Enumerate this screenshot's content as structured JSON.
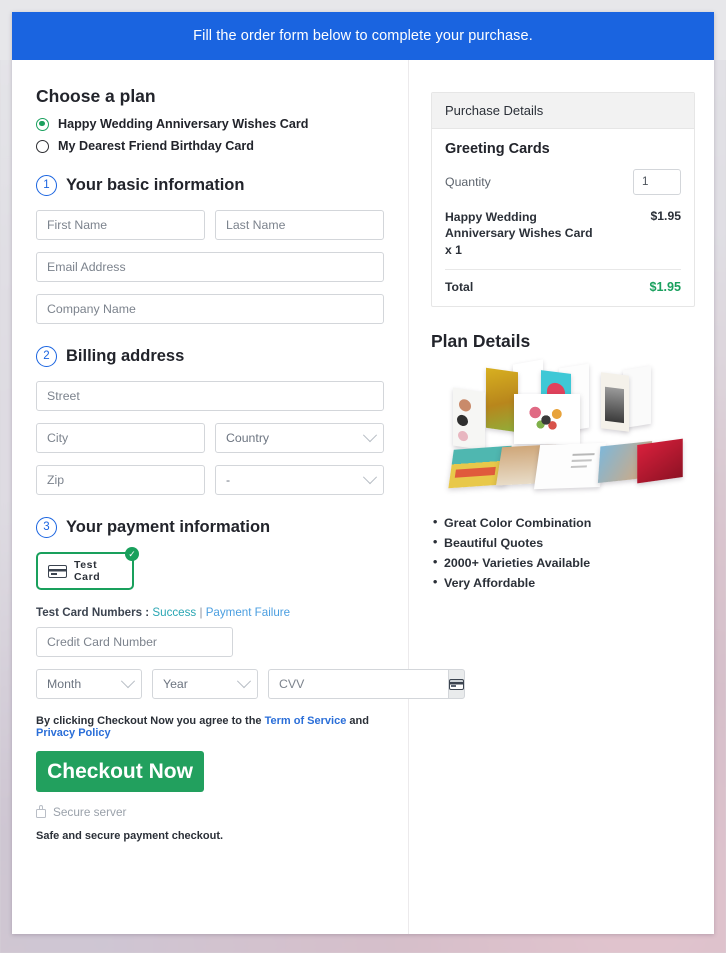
{
  "banner": {
    "text": "Fill the order form below to complete your purchase."
  },
  "plan": {
    "heading": "Choose a plan",
    "options": [
      {
        "label": "Happy Wedding Anniversary Wishes Card",
        "selected": true
      },
      {
        "label": "My Dearest Friend Birthday Card",
        "selected": false
      }
    ]
  },
  "steps": {
    "basic": {
      "num": "1",
      "label": "Your basic information"
    },
    "billing": {
      "num": "2",
      "label": "Billing address"
    },
    "payment": {
      "num": "3",
      "label": "Your payment information"
    }
  },
  "fields": {
    "first_name": {
      "placeholder": "First Name",
      "value": ""
    },
    "last_name": {
      "placeholder": "Last Name",
      "value": ""
    },
    "email": {
      "placeholder": "Email Address",
      "value": ""
    },
    "company": {
      "placeholder": "Company Name",
      "value": ""
    },
    "street": {
      "placeholder": "Street",
      "value": ""
    },
    "city": {
      "placeholder": "City",
      "value": ""
    },
    "country": {
      "placeholder": "Country",
      "selected": "Country"
    },
    "zip": {
      "placeholder": "Zip",
      "value": ""
    },
    "state": {
      "placeholder": "-",
      "selected": "-"
    },
    "card_number": {
      "placeholder": "Credit Card Number",
      "value": ""
    },
    "month": {
      "placeholder": "Month",
      "selected": "Month"
    },
    "year": {
      "placeholder": "Year",
      "selected": "Year"
    },
    "cvv": {
      "placeholder": "CVV",
      "value": ""
    }
  },
  "payment": {
    "tile_label": "Test  Card",
    "tile_selected": true,
    "test_numbers_prefix": "Test Card Numbers : ",
    "test_success_link": "Success",
    "test_separator": " | ",
    "test_failure_link": "Payment Failure"
  },
  "footer": {
    "terms_prefix": "By clicking Checkout Now you agree to the ",
    "terms_link": "Term of Service",
    "terms_middle": " and ",
    "privacy_link": "Privacy Policy",
    "checkout_label": "Checkout Now",
    "secure_server": "Secure server",
    "safe_note": "Safe and secure payment checkout."
  },
  "purchase": {
    "panel_title": "Purchase Details",
    "product_title": "Greeting Cards",
    "quantity_label": "Quantity",
    "quantity_value": "1",
    "line_item_name": "Happy Wedding Anniversary Wishes Card x 1",
    "line_item_price": "$1.95",
    "total_label": "Total",
    "total_value": "$1.95"
  },
  "plan_details": {
    "title": "Plan Details",
    "features": [
      "Great Color Combination",
      "Beautiful Quotes",
      "2000+ Varieties Available",
      "Very Affordable"
    ]
  },
  "colors": {
    "banner_blue": "#1a64e0",
    "accent_green": "#22a05e",
    "total_green": "#1aa05e",
    "link_blue": "#2a6ed8",
    "link_teal": "#2aa6b3"
  }
}
